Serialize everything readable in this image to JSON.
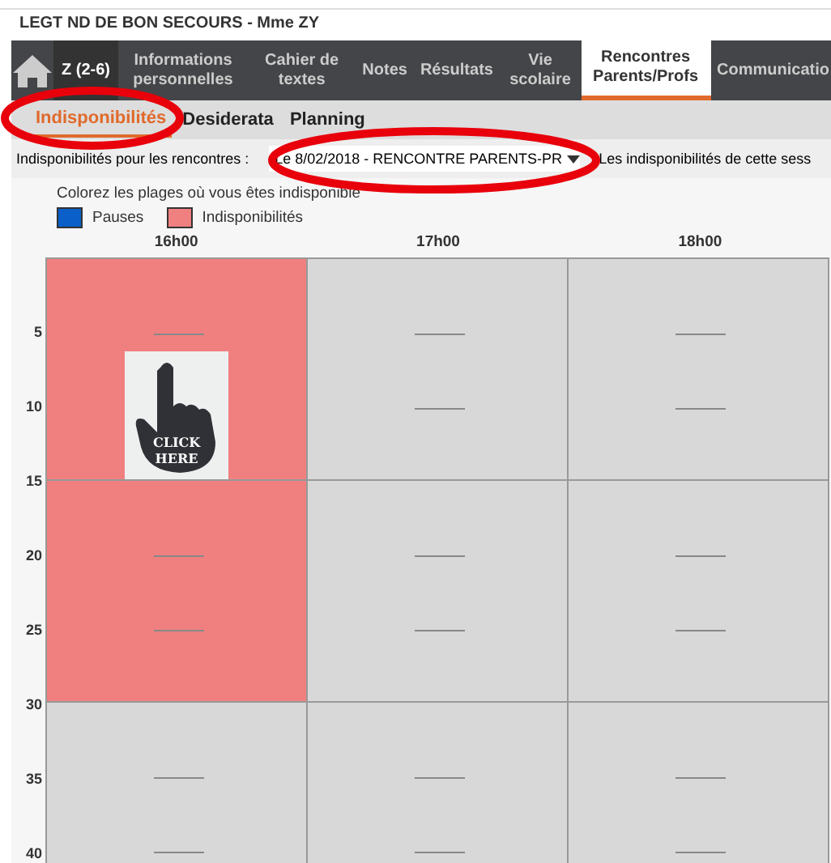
{
  "header": {
    "title": "LEGT ND DE BON SECOURS - Mme ZY"
  },
  "nav": {
    "class_label": "Z (2-6)",
    "tabs": [
      {
        "label": "Informations personnelles",
        "selected": false
      },
      {
        "label": "Cahier de textes",
        "selected": false
      },
      {
        "label": "Notes",
        "selected": false
      },
      {
        "label": "Résultats",
        "selected": false
      },
      {
        "label": "Vie scolaire",
        "selected": false
      },
      {
        "label": "Rencontres Parents/Profs",
        "selected": true
      },
      {
        "label": "Communicatio",
        "selected": false
      }
    ]
  },
  "subtabs": [
    {
      "label": "Indisponibilités",
      "selected": true
    },
    {
      "label": "Desiderata",
      "selected": false
    },
    {
      "label": "Planning",
      "selected": false
    }
  ],
  "filter": {
    "label": "Indisponibilités pour les rencontres :",
    "select_value": "Le 8/02/2018 - RENCONTRE PARENTS-PR",
    "note": "Les indisponibilités de cette sess"
  },
  "legend": {
    "instruction": "Colorez les plages où vous êtes indisponible",
    "items": [
      {
        "label": "Pauses",
        "color": "#0a5fc8"
      },
      {
        "label": "Indisponibilités",
        "color": "#f08080"
      }
    ]
  },
  "grid": {
    "columns": [
      "16h00",
      "17h00",
      "18h00"
    ],
    "time_labels": [
      "5",
      "10",
      "15",
      "20",
      "25",
      "30",
      "35",
      "40"
    ],
    "rows": [
      {
        "cells": [
          {
            "unavailable": true,
            "sticker": {
              "lines": [
                "CLICK",
                "HERE"
              ]
            }
          },
          {
            "unavailable": false
          },
          {
            "unavailable": false
          }
        ]
      },
      {
        "cells": [
          {
            "unavailable": true
          },
          {
            "unavailable": false
          },
          {
            "unavailable": false
          }
        ]
      },
      {
        "cells": [
          {
            "unavailable": false
          },
          {
            "unavailable": false
          },
          {
            "unavailable": false
          }
        ]
      }
    ]
  }
}
